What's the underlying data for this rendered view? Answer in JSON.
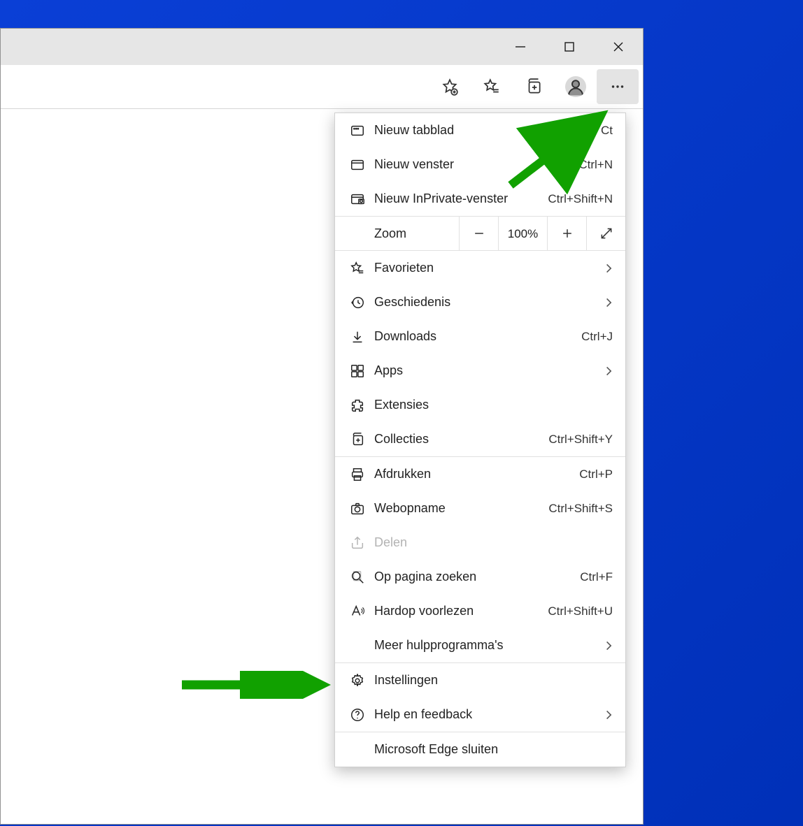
{
  "titlebar": {
    "minimize": "minimize",
    "maximize": "maximize",
    "close": "close"
  },
  "toolbar": {
    "add_favorite": "add-favorite",
    "favorites": "favorites",
    "collections": "collections",
    "profile": "profile",
    "more": "more"
  },
  "menu": {
    "new_tab": {
      "label": "Nieuw tabblad",
      "shortcut": "Ct"
    },
    "new_window": {
      "label": "Nieuw venster",
      "shortcut": "Ctrl+N"
    },
    "new_inprivate": {
      "label": "Nieuw InPrivate-venster",
      "shortcut": "Ctrl+Shift+N"
    },
    "zoom": {
      "label": "Zoom",
      "value": "100%"
    },
    "favorites": {
      "label": "Favorieten"
    },
    "history": {
      "label": "Geschiedenis"
    },
    "downloads": {
      "label": "Downloads",
      "shortcut": "Ctrl+J"
    },
    "apps": {
      "label": "Apps"
    },
    "extensions": {
      "label": "Extensies"
    },
    "collections": {
      "label": "Collecties",
      "shortcut": "Ctrl+Shift+Y"
    },
    "print": {
      "label": "Afdrukken",
      "shortcut": "Ctrl+P"
    },
    "web_capture": {
      "label": "Webopname",
      "shortcut": "Ctrl+Shift+S"
    },
    "share": {
      "label": "Delen"
    },
    "find": {
      "label": "Op pagina zoeken",
      "shortcut": "Ctrl+F"
    },
    "read_aloud": {
      "label": "Hardop voorlezen",
      "shortcut": "Ctrl+Shift+U"
    },
    "more_tools": {
      "label": "Meer hulpprogramma's"
    },
    "settings": {
      "label": "Instellingen"
    },
    "help": {
      "label": "Help en feedback"
    },
    "close_edge": {
      "label": "Microsoft Edge sluiten"
    }
  }
}
